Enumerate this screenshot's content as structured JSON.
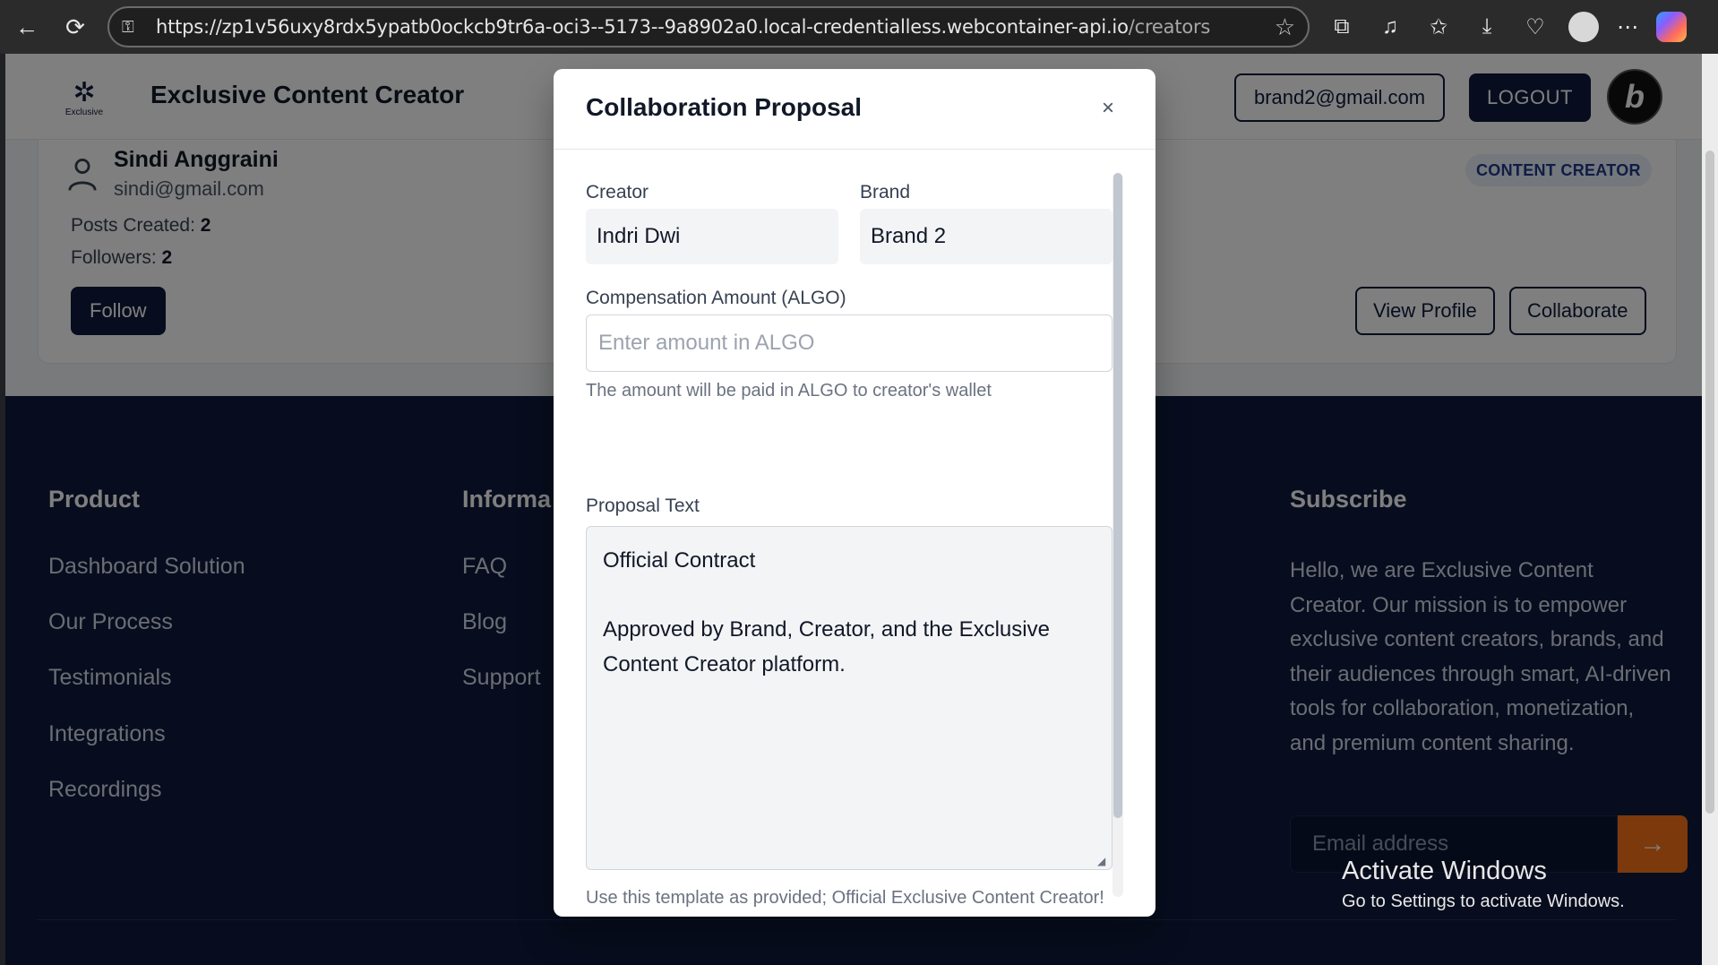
{
  "browser": {
    "url_main": "https://zp1v56uxy8rdx5ypatb0ockcb9tr6a-oci3--5173--9a8902a0.local-credentialless.webcontainer-api.io",
    "url_path": "/creators"
  },
  "header": {
    "title": "Exclusive Content Creator",
    "logo_text": "Exclusive",
    "user_email": "brand2@gmail.com",
    "logout_label": "LOGOUT",
    "badge_letter": "b"
  },
  "creator_card": {
    "name": "Sindi Anggraini",
    "email": "sindi@gmail.com",
    "posts_label": "Posts Created:",
    "posts_value": "2",
    "followers_label": "Followers:",
    "followers_value": "2",
    "follow_label": "Follow",
    "role_badge": "CONTENT CREATOR",
    "view_profile_label": "View Profile",
    "collaborate_label": "Collaborate"
  },
  "footer": {
    "product_heading": "Product",
    "product_links": [
      "Dashboard Solution",
      "Our Process",
      "Testimonials",
      "Integrations",
      "Recordings"
    ],
    "info_heading": "Informa",
    "info_links": [
      "FAQ",
      "Blog",
      "Support"
    ],
    "subscribe_heading": "Subscribe",
    "subscribe_text": "Hello, we are Exclusive Content Creator. Our mission is to empower exclusive content creators, brands, and their audiences through smart, AI-driven tools for collaboration, monetization, and premium content sharing.",
    "email_placeholder": "Email address",
    "subscribe_arrow": "→"
  },
  "modal": {
    "title": "Collaboration Proposal",
    "close": "×",
    "creator_label": "Creator",
    "creator_value": "Indri Dwi",
    "brand_label": "Brand",
    "brand_value": "Brand 2",
    "amount_label": "Compensation Amount (ALGO)",
    "amount_placeholder": "Enter amount in ALGO",
    "amount_hint": "The amount will be paid in ALGO to creator's wallet",
    "proposal_label": "Proposal Text",
    "proposal_line1": "Official Contract",
    "proposal_line2": "Approved by Brand, Creator, and the Exclusive Content Creator platform.",
    "proposal_hint": "Use this template as provided; Official Exclusive Content Creator!"
  },
  "windows_activation": {
    "title": "Activate Windows",
    "subtitle": "Go to Settings to activate Windows."
  }
}
